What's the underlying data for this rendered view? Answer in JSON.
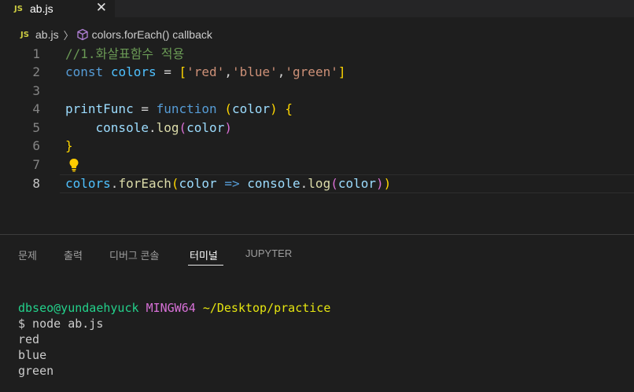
{
  "tab": {
    "icon": "JS",
    "label": "ab.js",
    "close": "✕"
  },
  "breadcrumb": {
    "icon": "JS",
    "file": "ab.js",
    "separator": "〉",
    "symbol_icon": "symbol-method-icon",
    "symbol": "colors.forEach() callback"
  },
  "editor": {
    "line_numbers": [
      "1",
      "2",
      "3",
      "4",
      "5",
      "6",
      "7",
      "8"
    ],
    "lines": {
      "l1": {
        "comment": "//1.화살표함수 적용"
      },
      "l2": {
        "kw": "const",
        "var": "colors",
        "eq": " = ",
        "open": "[",
        "s1": "'red'",
        "c1": ",",
        "s2": "'blue'",
        "c2": ",",
        "s3": "'green'",
        "close": "]"
      },
      "l4": {
        "name": "printFunc",
        "eq": " = ",
        "kw": "function",
        "sp": " ",
        "popen": "(",
        "param": "color",
        "pclose": ")",
        "sp2": " ",
        "bopen": "{"
      },
      "l5": {
        "indent": "    ",
        "obj": "console",
        "dot": ".",
        "fn": "log",
        "popen": "(",
        "arg": "color",
        "pclose": ")"
      },
      "l6": {
        "bclose": "}"
      },
      "l8": {
        "obj": "colors",
        "dot": ".",
        "fn": "forEach",
        "popen": "(",
        "param": "color",
        "arrow": " => ",
        "obj2": "console",
        "dot2": ".",
        "fn2": "log",
        "popen2": "(",
        "arg": "color",
        "pclose2": ")",
        "pclose": ")"
      }
    },
    "active_line": "8",
    "lightbulb_icon": "lightbulb-icon"
  },
  "panel": {
    "tabs": [
      "문제",
      "출력",
      "디버그 콘솔",
      "터미널",
      "JUPYTER"
    ],
    "active_tab": "터미널"
  },
  "terminal": {
    "user": "dbseo@yundaehyuck",
    "env": "MINGW64",
    "path": "~/Desktop/practice",
    "command": "$ node ab.js",
    "output": [
      "red",
      "blue",
      "green"
    ]
  },
  "colors": {
    "background": "#1e1e1e",
    "tabbar": "#252526",
    "comment": "#6a9955",
    "keyword": "#569cd6",
    "string": "#ce9178",
    "terminal_user": "#23d18b",
    "terminal_env": "#d670d6",
    "terminal_path": "#e5e510"
  }
}
